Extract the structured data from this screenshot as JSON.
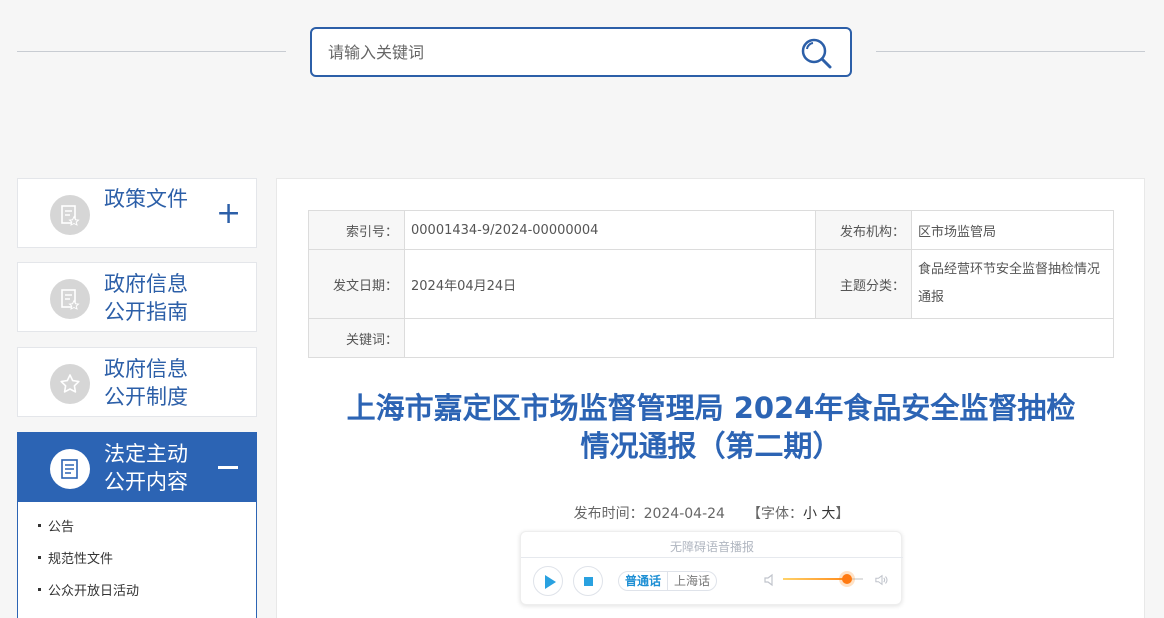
{
  "search": {
    "placeholder": "请输入关键词"
  },
  "sidebar": {
    "items": [
      {
        "label": "政策文件",
        "expanded": false
      },
      {
        "label_line1": "政府信息",
        "label_line2": "公开指南"
      },
      {
        "label_line1": "政府信息",
        "label_line2": "公开制度"
      },
      {
        "label_line1": "法定主动",
        "label_line2": "公开内容",
        "expanded": true
      }
    ],
    "sub_items": [
      "公告",
      "规范性文件",
      "公众开放日活动"
    ]
  },
  "meta": {
    "index_no_label": "索引号：",
    "index_no": "00001434-9/2024-00000004",
    "publisher_label": "发布机构：",
    "publisher": "区市场监管局",
    "date_label": "发文日期：",
    "date": "2024年04月24日",
    "topic_label": "主题分类：",
    "topic": "食品经营环节安全监督抽检情况通报",
    "keywords_label": "关键词：",
    "keywords": ""
  },
  "article": {
    "title_line1": "上海市嘉定区市场监督管理局 2024年食品安全监督抽检",
    "title_line2": "情况通报（第二期）",
    "publish_time_label": "发布时间：",
    "publish_time": "2024-04-24",
    "font_label_open": "【字体：",
    "font_small": "小",
    "font_large": "大",
    "font_label_close": "】"
  },
  "player": {
    "title": "无障碍语音播报",
    "lang_mandarin": "普通话",
    "lang_shanghai": "上海话",
    "volume": 0.8
  },
  "colors": {
    "accent": "#2c64b4",
    "player_accent": "#29a1e0",
    "volume": "#ff7a12"
  }
}
